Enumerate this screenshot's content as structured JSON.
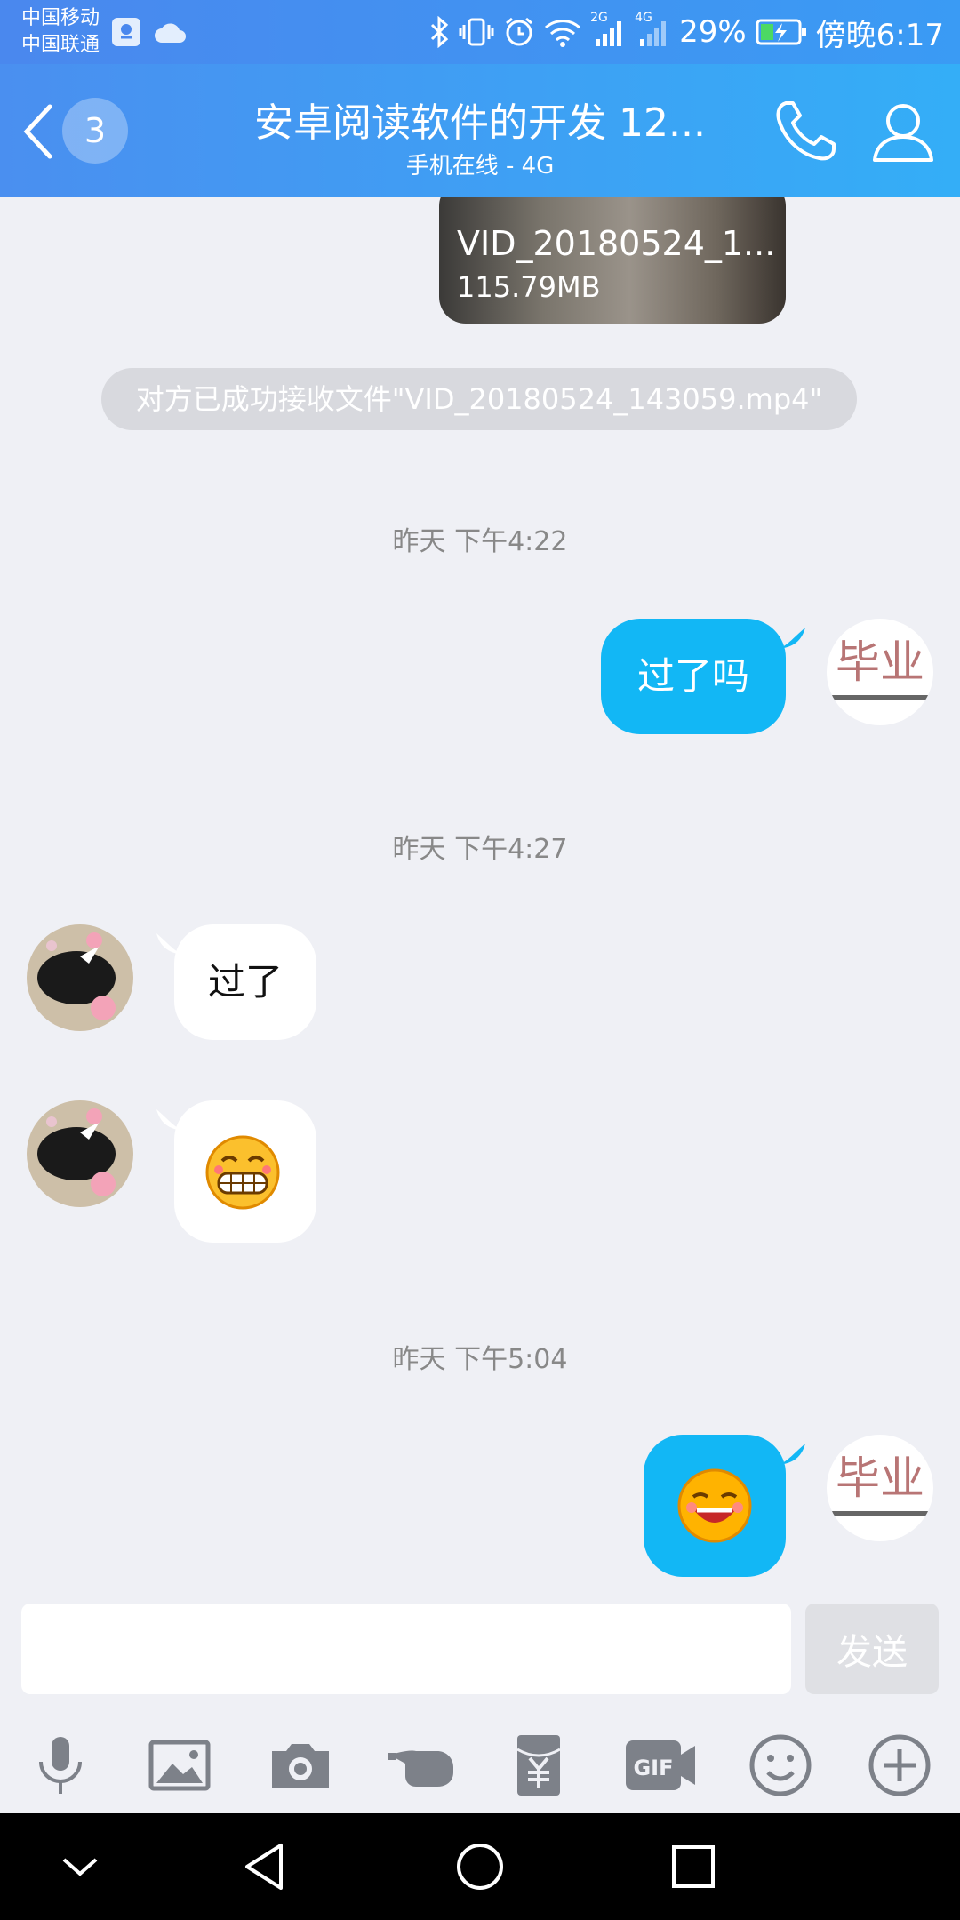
{
  "status_bar": {
    "carrier1": "中国移动",
    "carrier2": "中国联通",
    "net1": "2G",
    "net2": "4G",
    "battery": "29%",
    "time": "傍晚6:17"
  },
  "header": {
    "badge": "3",
    "title": "安卓阅读软件的开发 12...",
    "subtitle": "手机在线 - 4G"
  },
  "chat": {
    "file": {
      "name": "VID_20180524_1...",
      "size": "115.79MB"
    },
    "system_notice": "对方已成功接收文件\"VID_20180524_143059.mp4\"",
    "timestamps": [
      "昨天 下午4:22",
      "昨天 下午4:27",
      "昨天 下午5:04"
    ],
    "messages": [
      {
        "text": "过了吗"
      },
      {
        "text": "过了"
      }
    ],
    "avatar_text": "毕业"
  },
  "input": {
    "placeholder": "",
    "send_label": "发送"
  },
  "colors": {
    "header": "#3a9bf4",
    "bubble_out": "#12b7f5",
    "background": "#eff0f5"
  }
}
